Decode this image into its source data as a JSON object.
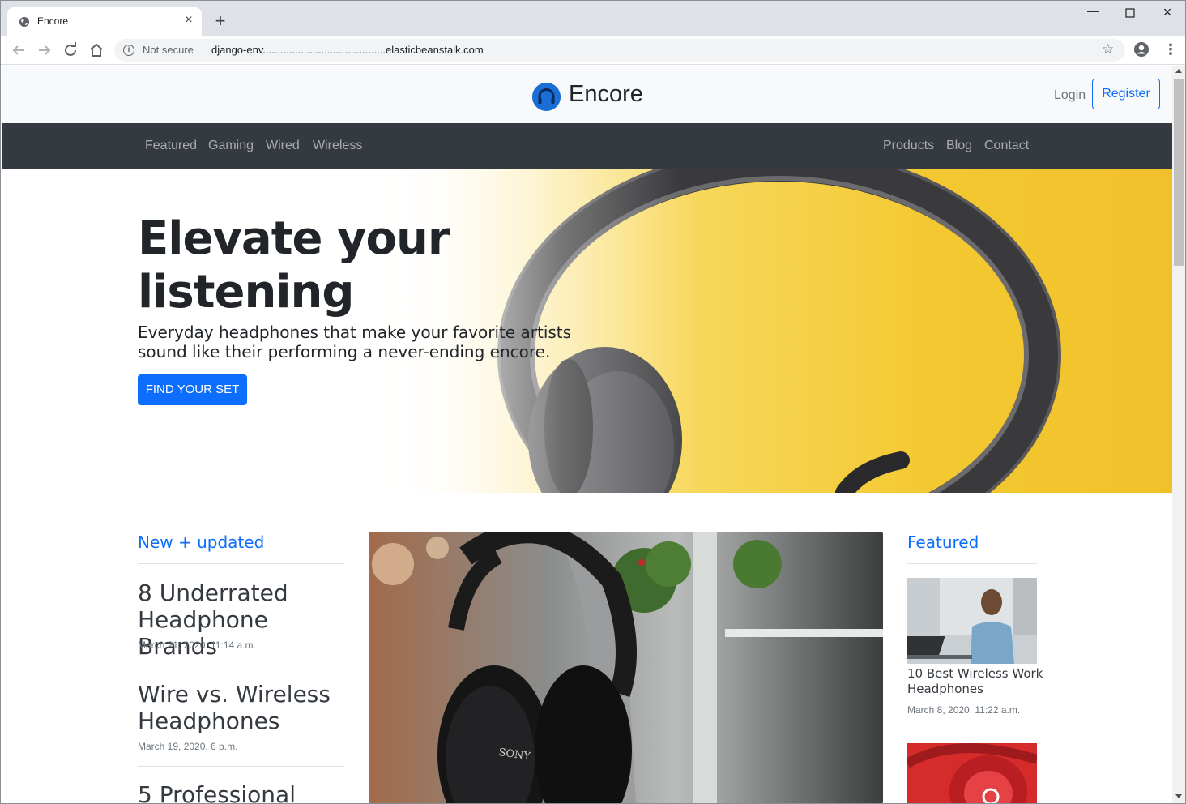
{
  "browser": {
    "tab_title": "Encore",
    "not_secure_label": "Not secure",
    "url": "django-env..........................................elasticbeanstalk.com"
  },
  "header": {
    "brand": "Encore",
    "login": "Login",
    "register": "Register"
  },
  "nav": {
    "left": [
      "Featured",
      "Gaming",
      "Wired",
      "Wireless"
    ],
    "right": [
      "Products",
      "Blog",
      "Contact"
    ]
  },
  "hero": {
    "title": "Elevate your listening",
    "subtitle": "Everyday headphones that make your favorite artists sound like their performing a never-ending encore.",
    "cta": "FIND YOUR SET"
  },
  "new_updated": {
    "heading": "New + updated",
    "articles": [
      {
        "title": "8 Underrated Headphone Brands",
        "date": "March 21, 2020, 11:14 a.m."
      },
      {
        "title": "Wire vs. Wireless Headphones",
        "date": "March 19, 2020, 6 p.m."
      },
      {
        "title": "5 Professional",
        "date": ""
      }
    ]
  },
  "featured": {
    "heading": "Featured",
    "items": [
      {
        "title": "10 Best Wireless Work Headphones",
        "date": "March 8, 2020, 11:22 a.m."
      }
    ]
  },
  "main_image": {
    "brand_text": "SONY"
  },
  "colors": {
    "primary": "#0d6efd",
    "navbar": "#343a40",
    "hero_yellow": "#f3c830"
  },
  "icons": {
    "favicon": "globe-icon",
    "back": "back-arrow-icon",
    "forward": "forward-arrow-icon",
    "reload": "reload-icon",
    "home": "home-icon",
    "bookmark": "star-icon",
    "profile": "profile-icon",
    "menu": "kebab-menu-icon"
  }
}
